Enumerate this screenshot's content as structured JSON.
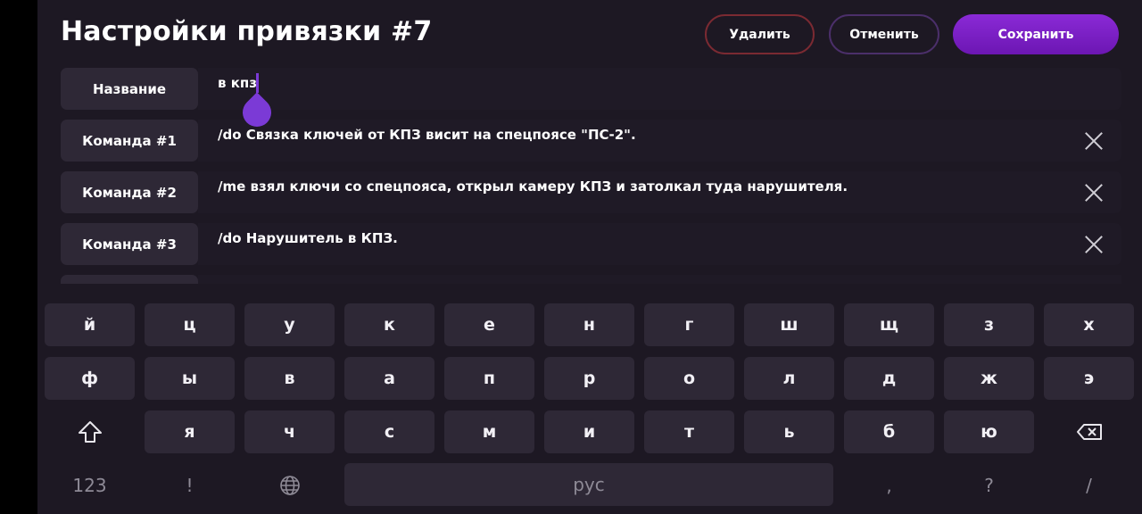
{
  "header": {
    "title": "Настройки привязки #7",
    "delete_label": "Удалить",
    "cancel_label": "Отменить",
    "save_label": "Сохранить"
  },
  "rows": [
    {
      "label": "Название",
      "value": "в кпз"
    },
    {
      "label": "Команда #1",
      "value": "/do Связка ключей от КПЗ висит на спецпоясе \"ПС-2\"."
    },
    {
      "label": "Команда #2",
      "value": "/me взял ключи со спецпояса, открыл камеру КПЗ и затолкал туда нарушителя."
    },
    {
      "label": "Команда #3",
      "value": "/do Нарушитель в КПЗ."
    }
  ],
  "keyboard": {
    "row1": [
      "й",
      "ц",
      "у",
      "к",
      "е",
      "н",
      "г",
      "ш",
      "щ",
      "з",
      "х"
    ],
    "row2": [
      "ф",
      "ы",
      "в",
      "а",
      "п",
      "р",
      "о",
      "л",
      "д",
      "ж",
      "э"
    ],
    "row3": [
      "я",
      "ч",
      "с",
      "м",
      "и",
      "т",
      "ь",
      "б",
      "ю"
    ],
    "bottom": {
      "num_label": "123",
      "exclaim": "!",
      "space_label": "рус",
      "comma": ",",
      "question": "?",
      "slash": "/"
    },
    "icons": {
      "shift": "shift-icon",
      "backspace": "backspace-icon",
      "globe": "globe-icon"
    }
  }
}
